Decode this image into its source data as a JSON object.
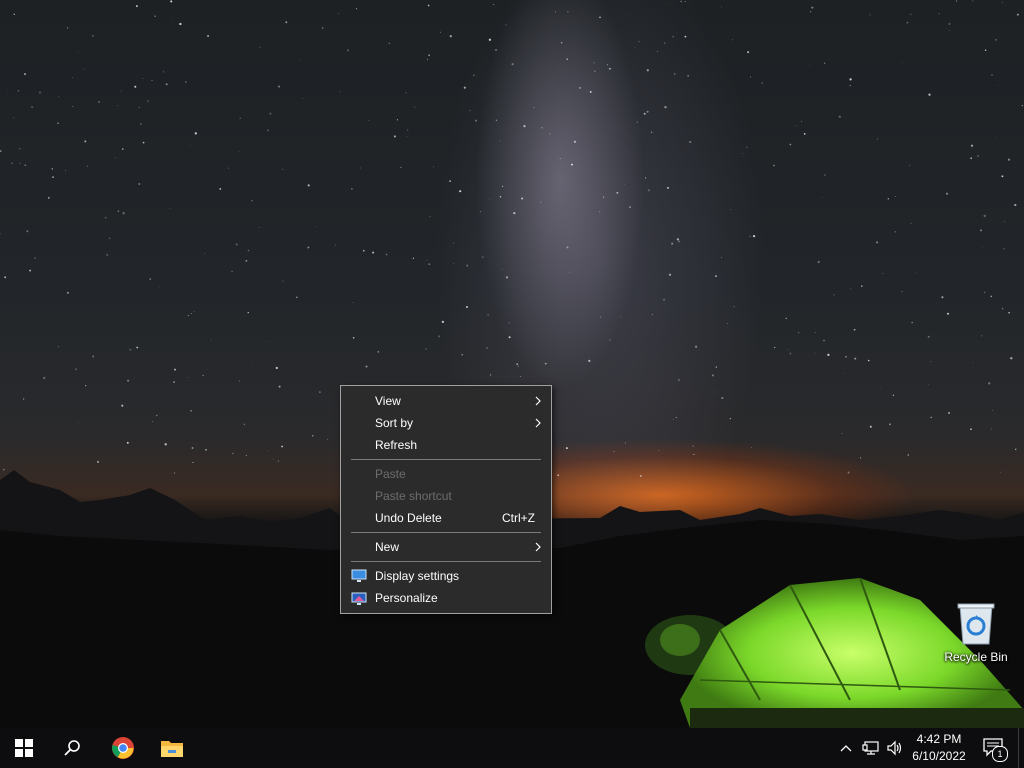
{
  "desktop": {
    "icons": [
      {
        "label": "Recycle Bin",
        "icon": "recycle-bin-icon"
      }
    ]
  },
  "context_menu": {
    "items": [
      {
        "label": "View",
        "has_submenu": true,
        "enabled": true
      },
      {
        "label": "Sort by",
        "has_submenu": true,
        "enabled": true
      },
      {
        "label": "Refresh",
        "enabled": true
      },
      {
        "separator": true
      },
      {
        "label": "Paste",
        "enabled": false
      },
      {
        "label": "Paste shortcut",
        "enabled": false
      },
      {
        "label": "Undo Delete",
        "shortcut": "Ctrl+Z",
        "enabled": true
      },
      {
        "separator": true
      },
      {
        "label": "New",
        "has_submenu": true,
        "enabled": true
      },
      {
        "separator": true
      },
      {
        "label": "Display settings",
        "icon": "display-settings-icon",
        "enabled": true
      },
      {
        "label": "Personalize",
        "icon": "personalize-icon",
        "enabled": true
      }
    ]
  },
  "taskbar": {
    "pinned": [
      {
        "name": "Start",
        "icon": "windows-start-icon"
      },
      {
        "name": "Search",
        "icon": "search-icon"
      },
      {
        "name": "Google Chrome",
        "icon": "chrome-icon"
      },
      {
        "name": "File Explorer",
        "icon": "file-explorer-icon"
      }
    ],
    "tray": {
      "time": "4:42 PM",
      "date": "6/10/2022",
      "notification_count": "1"
    }
  },
  "colors": {
    "menu_bg": "#2b2b2b",
    "menu_border": "#a0a0a0",
    "taskbar_bg": "#0d0d0f",
    "tent_green": "#7bd82a",
    "horizon_orange": "#ff7a1e"
  }
}
